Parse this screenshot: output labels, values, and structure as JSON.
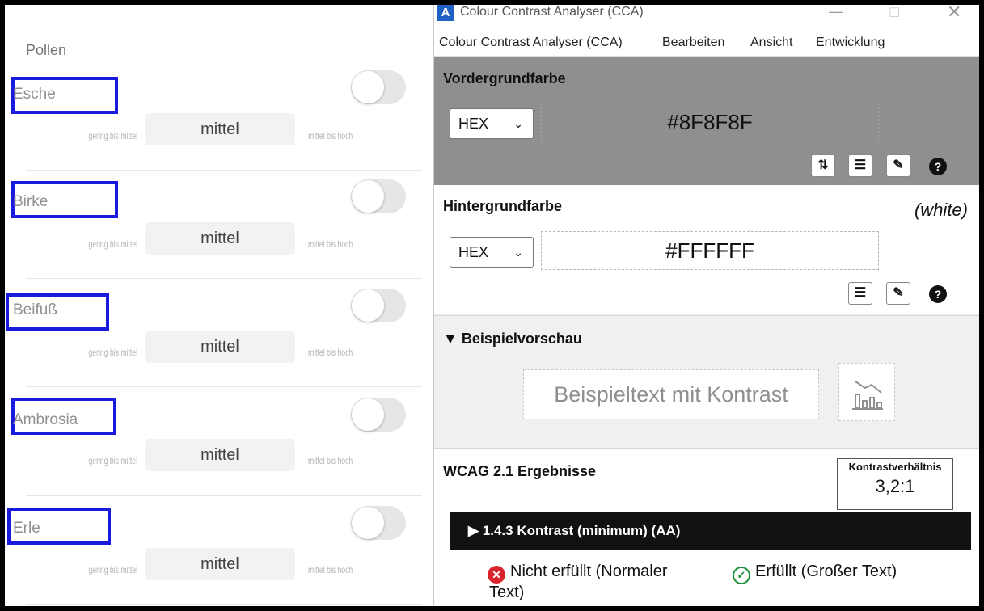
{
  "pollen": {
    "title": "Pollen",
    "rows": [
      {
        "name": "Esche",
        "low": "gering bis mittel",
        "mid": "mittel",
        "high": "mittel bis hoch"
      },
      {
        "name": "Birke",
        "low": "gering bis mittel",
        "mid": "mittel",
        "high": "mittel bis hoch"
      },
      {
        "name": "Beifuß",
        "low": "gering bis mittel",
        "mid": "mittel",
        "high": "mittel bis hoch"
      },
      {
        "name": "Ambrosia",
        "low": "gering bis mittel",
        "mid": "mittel",
        "high": "mittel bis hoch"
      },
      {
        "name": "Erle",
        "low": "gering bis mittel",
        "mid": "mittel",
        "high": "mittel bis hoch"
      }
    ],
    "highlight_color": "#1a1adf",
    "toggles_on": false
  },
  "cca": {
    "window_title": "Colour Contrast Analyser (CCA)",
    "app_icon": "A",
    "menu": [
      "Colour Contrast Analyser (CCA)",
      "Bearbeiten",
      "Ansicht",
      "Entwicklung"
    ],
    "foreground": {
      "title": "Vordergrundfarbe",
      "format": "HEX",
      "value": "#8F8F8F",
      "color": "#8F8F8F"
    },
    "background": {
      "title": "Hintergrundfarbe",
      "color_name": "(white)",
      "format": "HEX",
      "value": "#FFFFFF",
      "color": "#FFFFFF"
    },
    "preview": {
      "title": "▼ Beispielvorschau",
      "sample_text": "Beispieltext mit Kontrast"
    },
    "results": {
      "title": "WCAG 2.1 Ergebnisse",
      "ratio_label": "Kontrastverhältnis",
      "ratio_value": "3,2:1",
      "criterion": "▶ 1.4.3 Kontrast (minimum) (AA)",
      "normal_text_result": "Nicht erfüllt (Normaler",
      "normal_text_result_2": "Text)",
      "large_text_result": "Erfüllt (Großer Text)",
      "fail_color": "#d9232d",
      "pass_color": "#1e8f3a"
    }
  }
}
